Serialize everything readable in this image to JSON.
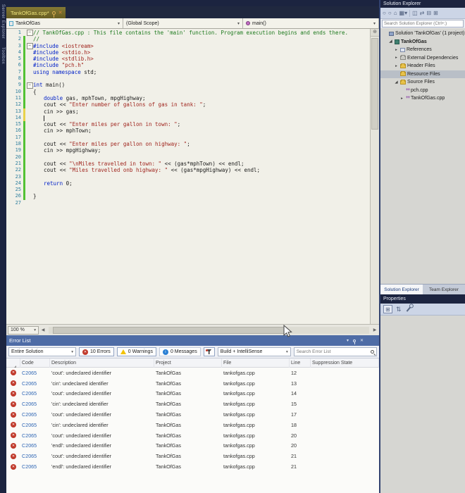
{
  "left_rail": {
    "tabs": [
      "Server Explorer",
      "Toolbox"
    ]
  },
  "editor": {
    "tab": {
      "title": "TankOfGas.cpp*"
    },
    "navbar": {
      "project": "TankOfGas",
      "scope": "(Global Scope)",
      "member": "main()"
    },
    "zoom_label": "100 %",
    "lines": [
      {
        "n": 1,
        "fold": true,
        "bar": "",
        "ind": 0,
        "tok": [
          [
            "c",
            "// TankOfGas.cpp : This file contains the 'main' function. Program execution begins and ends there."
          ]
        ]
      },
      {
        "n": 2,
        "fold": false,
        "bar": "g",
        "ind": 0,
        "tok": [
          [
            "c",
            "//"
          ]
        ]
      },
      {
        "n": 3,
        "fold": true,
        "bar": "g",
        "ind": 0,
        "tok": [
          [
            "k",
            "#include"
          ],
          [
            "p",
            " "
          ],
          [
            "s",
            "<iostream>"
          ]
        ]
      },
      {
        "n": 4,
        "fold": false,
        "bar": "g",
        "ind": 0,
        "tok": [
          [
            "k",
            "#include"
          ],
          [
            "p",
            " "
          ],
          [
            "s",
            "<stdio.h>"
          ]
        ]
      },
      {
        "n": 5,
        "fold": false,
        "bar": "g",
        "ind": 0,
        "tok": [
          [
            "k",
            "#include"
          ],
          [
            "p",
            " "
          ],
          [
            "s",
            "<stdlib.h>"
          ]
        ]
      },
      {
        "n": 6,
        "fold": false,
        "bar": "g",
        "ind": 0,
        "tok": [
          [
            "k",
            "#include"
          ],
          [
            "p",
            " "
          ],
          [
            "s",
            "\"pch.h\""
          ]
        ]
      },
      {
        "n": 7,
        "fold": false,
        "bar": "g",
        "ind": 0,
        "tok": [
          [
            "k",
            "using"
          ],
          [
            "p",
            " "
          ],
          [
            "k",
            "namespace"
          ],
          [
            "p",
            " std;"
          ]
        ]
      },
      {
        "n": 8,
        "fold": false,
        "bar": "g",
        "ind": 0,
        "tok": []
      },
      {
        "n": 9,
        "fold": true,
        "bar": "g",
        "ind": 0,
        "tok": [
          [
            "k",
            "int"
          ],
          [
            "p",
            " main()"
          ]
        ]
      },
      {
        "n": 10,
        "fold": false,
        "bar": "g",
        "ind": 0,
        "tok": [
          [
            "p",
            "{"
          ]
        ]
      },
      {
        "n": 11,
        "fold": false,
        "bar": "g",
        "ind": 1,
        "tok": [
          [
            "k",
            "double"
          ],
          [
            "p",
            " gas, mphTown, mpgHighway;"
          ]
        ]
      },
      {
        "n": 12,
        "fold": false,
        "bar": "g",
        "ind": 1,
        "tok": [
          [
            "p",
            "cout << "
          ],
          [
            "s",
            "\"Enter number of gallons of gas in tank: \""
          ],
          [
            "p",
            ";"
          ]
        ]
      },
      {
        "n": 13,
        "fold": false,
        "bar": "y",
        "ind": 1,
        "tok": [
          [
            "p",
            "cin >> gas;"
          ]
        ]
      },
      {
        "n": 14,
        "fold": false,
        "bar": "y",
        "ind": 1,
        "cursor": true,
        "tok": []
      },
      {
        "n": 15,
        "fold": false,
        "bar": "g",
        "ind": 1,
        "tok": [
          [
            "p",
            "cout << "
          ],
          [
            "s",
            "\"Enter miles per gallon in town: \""
          ],
          [
            "p",
            ";"
          ]
        ]
      },
      {
        "n": 16,
        "fold": false,
        "bar": "g",
        "ind": 1,
        "tok": [
          [
            "p",
            "cin >> mphTown;"
          ]
        ]
      },
      {
        "n": 17,
        "fold": false,
        "bar": "g",
        "ind": 0,
        "tok": []
      },
      {
        "n": 18,
        "fold": false,
        "bar": "g",
        "ind": 1,
        "tok": [
          [
            "p",
            "cout << "
          ],
          [
            "s",
            "\"Enter miles per gallon on highway: \""
          ],
          [
            "p",
            ";"
          ]
        ]
      },
      {
        "n": 19,
        "fold": false,
        "bar": "g",
        "ind": 1,
        "tok": [
          [
            "p",
            "cin >> mpgHighway;"
          ]
        ]
      },
      {
        "n": 20,
        "fold": false,
        "bar": "g",
        "ind": 0,
        "tok": []
      },
      {
        "n": 21,
        "fold": false,
        "bar": "g",
        "ind": 1,
        "tok": [
          [
            "p",
            "cout << "
          ],
          [
            "s",
            "\"\\nMiles travelled in town: \""
          ],
          [
            "p",
            " << (gas*mphTown) << endl;"
          ]
        ]
      },
      {
        "n": 22,
        "fold": false,
        "bar": "g",
        "ind": 1,
        "tok": [
          [
            "p",
            "cout << "
          ],
          [
            "s",
            "\"Miles travelled onb highway: \""
          ],
          [
            "p",
            " << (gas*mpgHighway) << endl;"
          ]
        ]
      },
      {
        "n": 23,
        "fold": false,
        "bar": "g",
        "ind": 0,
        "tok": []
      },
      {
        "n": 24,
        "fold": false,
        "bar": "g",
        "ind": 1,
        "tok": [
          [
            "k",
            "return"
          ],
          [
            "p",
            " 0;"
          ]
        ]
      },
      {
        "n": 25,
        "fold": false,
        "bar": "g",
        "ind": 0,
        "tok": []
      },
      {
        "n": 26,
        "fold": false,
        "bar": "g",
        "ind": 0,
        "tok": [
          [
            "p",
            "}"
          ]
        ]
      },
      {
        "n": 27,
        "fold": false,
        "bar": "",
        "ind": 0,
        "tok": []
      }
    ]
  },
  "solution_explorer": {
    "title": "Solution Explorer",
    "search_placeholder": "Search Solution Explorer (Ctrl+;)",
    "tree": [
      {
        "label": "Solution 'TankOfGas' (1 project)",
        "icon": "solution",
        "ind": 0,
        "exp": "none",
        "bold": false,
        "selected": false
      },
      {
        "label": "TankOfGas",
        "icon": "project",
        "ind": 1,
        "exp": "open",
        "bold": true,
        "selected": false
      },
      {
        "label": "References",
        "icon": "references",
        "ind": 2,
        "exp": "closed",
        "bold": false,
        "selected": false
      },
      {
        "label": "External Dependencies",
        "icon": "dependencies",
        "ind": 2,
        "exp": "closed",
        "bold": false,
        "selected": false
      },
      {
        "label": "Header Files",
        "icon": "folder",
        "ind": 2,
        "exp": "closed",
        "bold": false,
        "selected": false
      },
      {
        "label": "Resource Files",
        "icon": "folder",
        "ind": 2,
        "exp": "none",
        "bold": false,
        "selected": true
      },
      {
        "label": "Source Files",
        "icon": "folder-open",
        "ind": 2,
        "exp": "open",
        "bold": false,
        "selected": false
      },
      {
        "label": "pch.cpp",
        "icon": "cpp",
        "ind": 3,
        "exp": "none",
        "bold": false,
        "selected": false
      },
      {
        "label": "TankOfGas.cpp",
        "icon": "cpp",
        "ind": 3,
        "exp": "closed",
        "bold": false,
        "selected": false
      }
    ],
    "bottom_tabs": [
      {
        "label": "Solution Explorer",
        "active": true
      },
      {
        "label": "Team Explorer",
        "active": false
      }
    ]
  },
  "properties_panel": {
    "title": "Properties"
  },
  "error_list": {
    "title": "Error List",
    "filter_scope": "Entire Solution",
    "errors_label": "10 Errors",
    "warnings_label": "0 Warnings",
    "messages_label": "0 Messages",
    "source_filter": "Build + IntelliSense",
    "search_placeholder": "Search Error List",
    "columns": [
      "Code",
      "Description",
      "Project",
      "File",
      "Line",
      "Suppression State"
    ],
    "rows": [
      {
        "code": "C2065",
        "description": "'cout': undeclared identifier",
        "project": "TankOfGas",
        "file": "tankofgas.cpp",
        "line": "12",
        "suppression": ""
      },
      {
        "code": "C2065",
        "description": "'cin': undeclared identifier",
        "project": "TankOfGas",
        "file": "tankofgas.cpp",
        "line": "13",
        "suppression": ""
      },
      {
        "code": "C2065",
        "description": "'cout': undeclared identifier",
        "project": "TankOfGas",
        "file": "tankofgas.cpp",
        "line": "14",
        "suppression": ""
      },
      {
        "code": "C2065",
        "description": "'cin': undeclared identifier",
        "project": "TankOfGas",
        "file": "tankofgas.cpp",
        "line": "15",
        "suppression": ""
      },
      {
        "code": "C2065",
        "description": "'cout': undeclared identifier",
        "project": "TankOfGas",
        "file": "tankofgas.cpp",
        "line": "17",
        "suppression": ""
      },
      {
        "code": "C2065",
        "description": "'cin': undeclared identifier",
        "project": "TankOfGas",
        "file": "tankofgas.cpp",
        "line": "18",
        "suppression": ""
      },
      {
        "code": "C2065",
        "description": "'cout': undeclared identifier",
        "project": "TankOfGas",
        "file": "tankofgas.cpp",
        "line": "20",
        "suppression": ""
      },
      {
        "code": "C2065",
        "description": "'endl': undeclared identifier",
        "project": "TankOfGas",
        "file": "tankofgas.cpp",
        "line": "20",
        "suppression": ""
      },
      {
        "code": "C2065",
        "description": "'cout': undeclared identifier",
        "project": "TankOfGas",
        "file": "tankofgas.cpp",
        "line": "21",
        "suppression": ""
      },
      {
        "code": "C2065",
        "description": "'endl': undeclared identifier",
        "project": "TankOfGas",
        "file": "tankofgas.cpp",
        "line": "21",
        "suppression": ""
      }
    ]
  },
  "colors": {
    "accent_navy": "#1c2440",
    "error_header_blue": "#4e6ca6",
    "active_tab_gold": "#756a2c",
    "change_bar_green": "#53c234",
    "change_bar_yellow": "#e8d24a",
    "error_red": "#c0392b",
    "error_code_blue": "#2f66b5"
  }
}
